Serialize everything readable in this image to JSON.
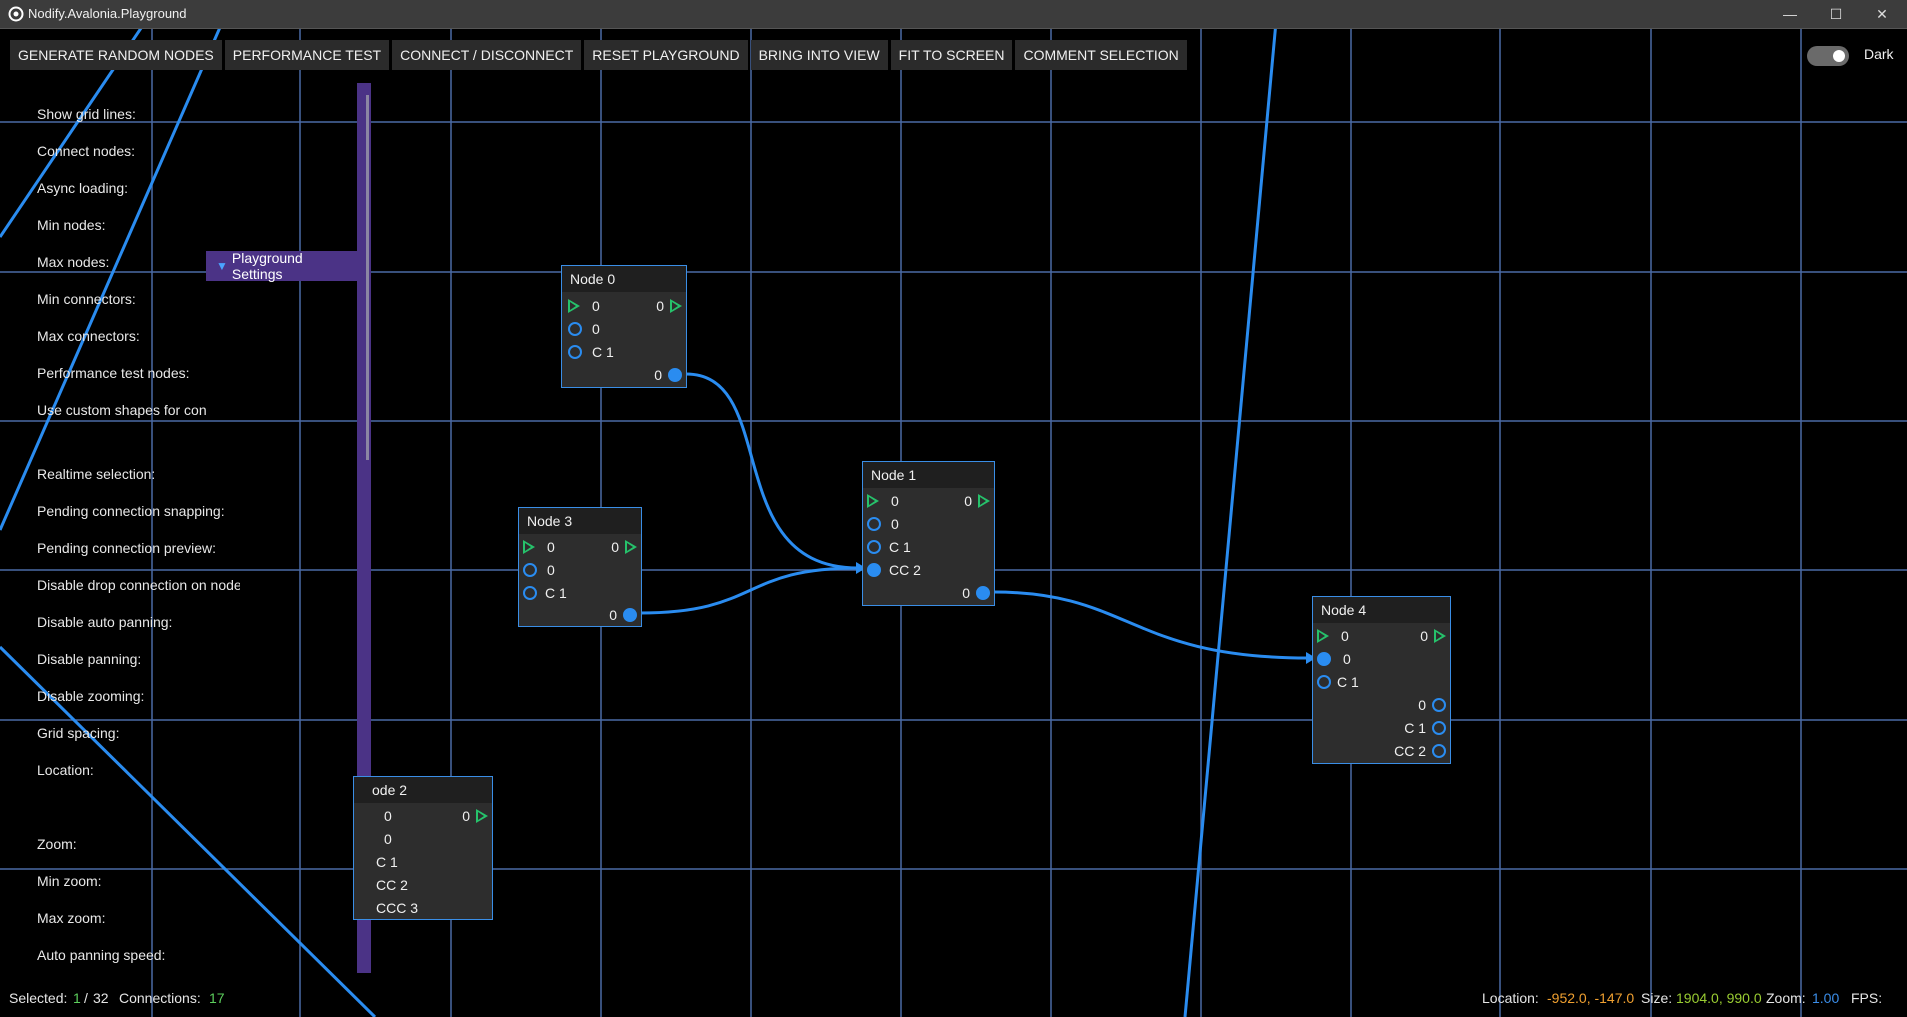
{
  "window": {
    "title": "Nodify.Avalonia.Playground",
    "minimize": "—",
    "maximize": "☐",
    "close": "✕"
  },
  "toolbar": [
    "GENERATE RANDOM NODES",
    "PERFORMANCE TEST",
    "CONNECT / DISCONNECT",
    "RESET PLAYGROUND",
    "BRING INTO VIEW",
    "FIT TO SCREEN",
    "COMMENT SELECTION"
  ],
  "theme": {
    "label": "Dark",
    "enabled": true
  },
  "settings": {
    "header": "Playground Settings",
    "labels": [
      "Show grid lines:",
      "Connect nodes:",
      "Async loading:",
      "Min nodes:",
      "Max nodes:",
      "Min connectors:",
      "Max connectors:",
      "Performance test nodes:",
      "Use custom shapes for conn",
      "Realtime selection:",
      "Pending connection snapping:",
      "Pending connection preview:",
      "Disable drop connection on node",
      "Disable auto panning:",
      "Disable panning:",
      "Disable zooming:",
      "Grid spacing:",
      "Location:",
      "Zoom:",
      "Min zoom:",
      "Max zoom:",
      "Auto panning speed:"
    ]
  },
  "nodes": {
    "node0": {
      "title": "Node 0",
      "in": [
        "0",
        "0",
        "C 1"
      ],
      "out": [
        "0",
        "0"
      ]
    },
    "node1": {
      "title": "Node 1",
      "in": [
        "0",
        "0",
        "C 1",
        "CC 2"
      ],
      "out": [
        "0",
        "0"
      ]
    },
    "node2": {
      "title": "ode 2",
      "in": [
        "0",
        "0",
        "C 1",
        "CC 2",
        "CCC 3"
      ],
      "out": [
        "0"
      ]
    },
    "node3": {
      "title": "Node 3",
      "in": [
        "0",
        "0",
        "C 1"
      ],
      "out": [
        "0",
        "0"
      ]
    },
    "node4": {
      "title": "Node 4",
      "in": [
        "0",
        "0",
        "C 1"
      ],
      "out": [
        "0",
        "0",
        "C 1",
        "CC 2"
      ]
    }
  },
  "status": {
    "selected_label": "Selected:",
    "selected_count": "1",
    "selected_sep": "/",
    "selected_total": "32",
    "connections_label": "Connections:",
    "connections_count": "17",
    "location_label": "Location:",
    "location_value": "-952.0, -147.0",
    "size_label": "Size:",
    "size_value": "1904.0, 990.0",
    "zoom_label": "Zoom:",
    "zoom_value": "1.00",
    "fps_label": "FPS:",
    "colors": {
      "location": "#f0a030",
      "size": "#9acd32",
      "zoom": "#3b8eea",
      "counts": "#5ccf5c"
    }
  }
}
